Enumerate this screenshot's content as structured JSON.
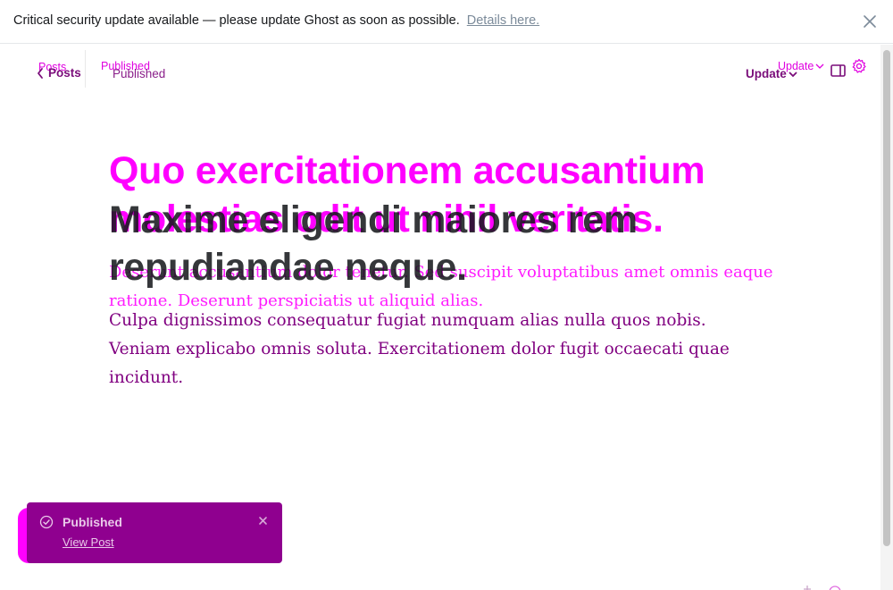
{
  "banner": {
    "message": "Critical security update available — please update Ghost as soon as possible.",
    "link_label": "Details here.",
    "close_icon": "close-icon"
  },
  "header": {
    "posts_ghost_label": "Posts",
    "status_ghost_label": "Published",
    "back_label": "Posts",
    "status_label": "Published",
    "update_label": "Update",
    "update_ghost_label": "Update",
    "sidebar_icon": "sidebar-toggle-icon",
    "settings_icon": "gear-icon"
  },
  "article": {
    "title_overlay": "Quo exercitationem accusantium molestias odit ut nihil veritatis.",
    "title": "Maxime eligendi maiores rem repudiandae neque.",
    "excerpt_overlay": "Deserunt accusantium dolor tenetur. Sed suscipit voluptatibus amet omnis eaque ratione. Deserunt perspiciatis ut aliquid alias.",
    "body": "Culpa dignissimos consequatur fugiat numquam alias nulla quos nobis. Veniam explicabo omnis soluta. Exercitationem dolor fugit occaecati quae incidunt."
  },
  "toast": {
    "title": "Published",
    "link_label": "View Post",
    "check_icon": "check-circle-icon",
    "close_icon": "close-icon"
  },
  "colors": {
    "accent": "#ff00ff",
    "accent_dark": "#8f008f",
    "text": "#15171a",
    "link_muted": "#7c8b9a"
  }
}
